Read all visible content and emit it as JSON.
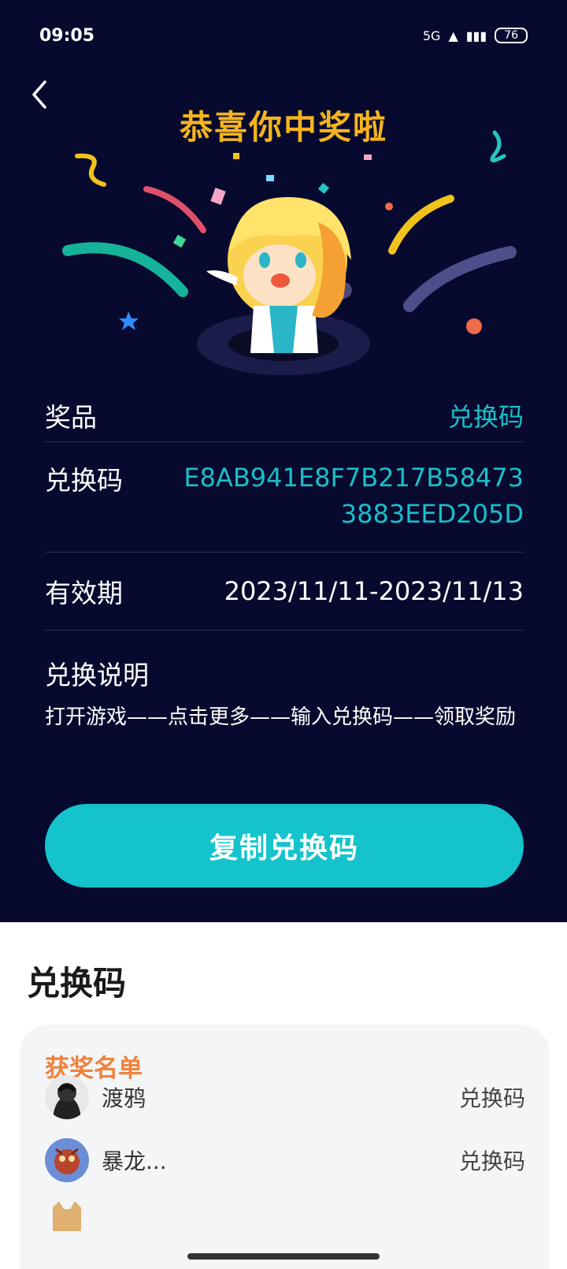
{
  "status_bar": {
    "time": "09:05",
    "network": "5G",
    "battery": "76"
  },
  "header": {
    "title": "恭喜你中奖啦"
  },
  "prize": {
    "prize_label": "奖品",
    "prize_value": "兑换码",
    "code_label": "兑换码",
    "code_value": "E8AB941E8F7B217B584733883EED205D",
    "validity_label": "有效期",
    "validity_value": "2023/11/11-2023/11/13",
    "instructions_title": "兑换说明",
    "instructions_text": "打开游戏——点击更多——输入兑换码——领取奖励",
    "copy_button": "复制兑换码"
  },
  "section": {
    "title": "兑换码"
  },
  "winners": {
    "heading": "获奖名单",
    "items": [
      {
        "name": "渡鸦",
        "prize": "兑换码"
      },
      {
        "name": "暴龙...",
        "prize": "兑换码"
      }
    ]
  },
  "colors": {
    "background": "#070a2e",
    "accent": "#14c3cc",
    "title": "#f5b41e",
    "winner_heading": "#f0823c"
  }
}
